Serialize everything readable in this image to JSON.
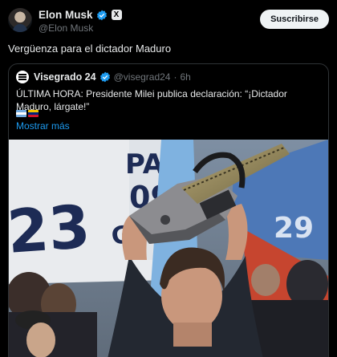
{
  "author": {
    "name": "Elon Musk",
    "handle": "@Elon Musk",
    "badge": "X",
    "subscribe_label": "Suscribirse"
  },
  "tweet": {
    "text": "Vergüenza para el dictador Maduro"
  },
  "quoted": {
    "name": "Visegrado 24",
    "handle": "@visegrad24",
    "separator": "·",
    "time": "6h",
    "text": "ÚLTIMA HORA: Presidente Milei publica declaración: “¡Dictador Maduro, lárgate!”",
    "flags": [
      "argentina-flag",
      "venezuela-flag"
    ],
    "show_more": "Mostrar más",
    "photo_banner_text": [
      "23",
      "PA",
      "09",
      "GANA",
      "29"
    ]
  },
  "colors": {
    "background": "#000000",
    "text": "#e7e9ea",
    "muted": "#71767b",
    "link": "#1d9bf0",
    "verified": "#1d9bf0",
    "border": "#2f3336"
  }
}
